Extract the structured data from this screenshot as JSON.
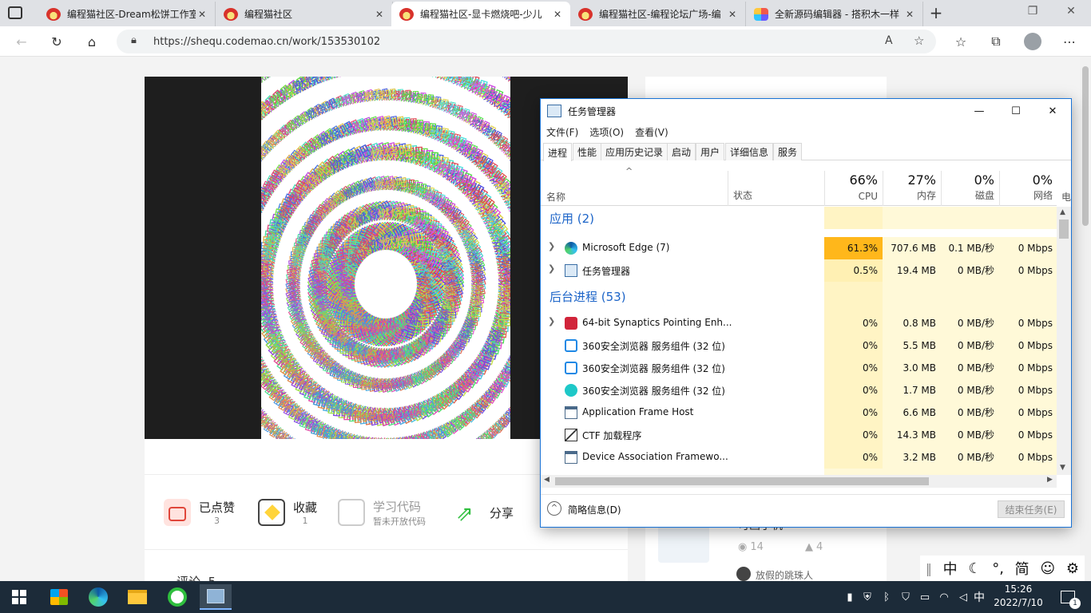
{
  "browser": {
    "tabs": [
      {
        "title": "编程猫社区-Dream松饼工作室",
        "icon": "codemao-icon",
        "active": false
      },
      {
        "title": "编程猫社区",
        "icon": "codemao-icon",
        "active": false
      },
      {
        "title": "编程猫社区-显卡燃烧吧-少儿",
        "icon": "codemao-icon",
        "active": true
      },
      {
        "title": "编程猫社区-编程论坛广场-编",
        "icon": "codemao-icon",
        "active": false
      },
      {
        "title": "全新源码编辑器 - 搭积木一样",
        "icon": "code-editor-icon",
        "active": false
      }
    ],
    "url": "https://shequ.codemao.cn/work/153530102"
  },
  "work": {
    "art_word": "燃烧吧",
    "actions": [
      {
        "label": "已点赞",
        "sub": "3"
      },
      {
        "label": "收藏",
        "sub": "1"
      },
      {
        "label": "学习代码",
        "sub": "暂未开放代码"
      },
      {
        "label": "分享",
        "sub": ""
      }
    ],
    "comments_label": "评论",
    "comments_count": "5"
  },
  "sidebar": {
    "card_title": "可画了机",
    "views": "14",
    "likes": "4",
    "author": "放假的跳珠人"
  },
  "taskmgr": {
    "title": "任务管理器",
    "menu": [
      "文件(F)",
      "选项(O)",
      "查看(V)"
    ],
    "tabs": [
      "进程",
      "性能",
      "应用历史记录",
      "启动",
      "用户",
      "详细信息",
      "服务"
    ],
    "columns": {
      "name": "名称",
      "status": "状态",
      "cpu": {
        "pct": "66%",
        "label": "CPU"
      },
      "mem": {
        "pct": "27%",
        "label": "内存"
      },
      "disk": {
        "pct": "0%",
        "label": "磁盘"
      },
      "net": {
        "pct": "0%",
        "label": "网络"
      },
      "power": "电"
    },
    "groups": {
      "apps": "应用 (2)",
      "background": "后台进程 (53)"
    },
    "apps": [
      {
        "name": "Microsoft Edge (7)",
        "cpu": "61.3%",
        "mem": "707.6 MB",
        "disk": "0.1 MB/秒",
        "net": "0 Mbps",
        "icon": "edge-icon"
      },
      {
        "name": "任务管理器",
        "cpu": "0.5%",
        "mem": "19.4 MB",
        "disk": "0 MB/秒",
        "net": "0 Mbps",
        "icon": "taskmgr-icon"
      }
    ],
    "background": [
      {
        "name": "64-bit Synaptics Pointing Enh...",
        "cpu": "0%",
        "mem": "0.8 MB",
        "disk": "0 MB/秒",
        "net": "0 Mbps",
        "icon": "synaptics-icon"
      },
      {
        "name": "360安全浏览器 服务组件 (32 位)",
        "cpu": "0%",
        "mem": "5.5 MB",
        "disk": "0 MB/秒",
        "net": "0 Mbps",
        "icon": "360-browser-icon"
      },
      {
        "name": "360安全浏览器 服务组件 (32 位)",
        "cpu": "0%",
        "mem": "3.0 MB",
        "disk": "0 MB/秒",
        "net": "0 Mbps",
        "icon": "360-browser-icon"
      },
      {
        "name": "360安全浏览器 服务组件 (32 位)",
        "cpu": "0%",
        "mem": "1.7 MB",
        "disk": "0 MB/秒",
        "net": "0 Mbps",
        "icon": "360-chat-icon"
      },
      {
        "name": "Application Frame Host",
        "cpu": "0%",
        "mem": "6.6 MB",
        "disk": "0 MB/秒",
        "net": "0 Mbps",
        "icon": "window-icon"
      },
      {
        "name": "CTF 加载程序",
        "cpu": "0%",
        "mem": "14.3 MB",
        "disk": "0 MB/秒",
        "net": "0 Mbps",
        "icon": "ctf-icon"
      },
      {
        "name": "Device Association Framewo...",
        "cpu": "0%",
        "mem": "3.2 MB",
        "disk": "0 MB/秒",
        "net": "0 Mbps",
        "icon": "window-icon"
      }
    ],
    "fewer_details": "简略信息(D)",
    "end_task": "结束任务(E)"
  },
  "ime": {
    "mode": "中",
    "punct": "°,",
    "variant": "简"
  },
  "taskbar": {
    "tray_lang": "中",
    "time": "15:26",
    "date": "2022/7/10",
    "notifications": "1"
  },
  "colors": {
    "cpu_high": "#ffb71b",
    "cpu_bg": "#fff4c4",
    "group_blue": "#1c64c8",
    "taskbar": "#1c2b39"
  }
}
